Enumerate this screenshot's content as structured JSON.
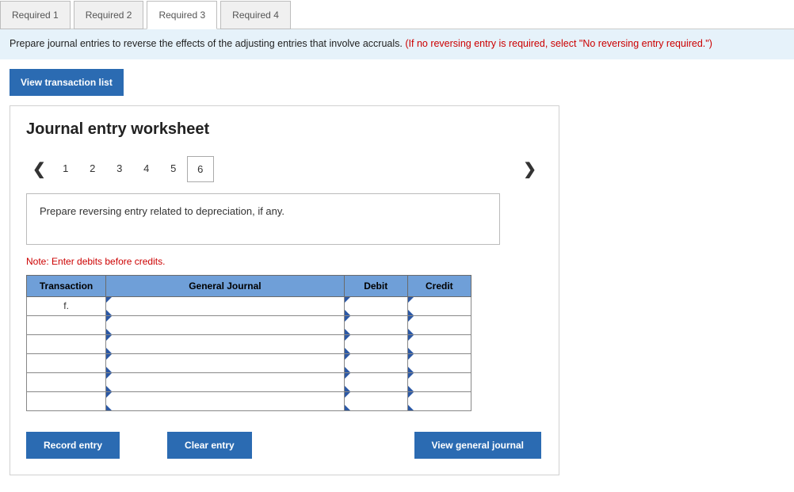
{
  "tabs": {
    "items": [
      {
        "label": "Required 1"
      },
      {
        "label": "Required 2"
      },
      {
        "label": "Required 3"
      },
      {
        "label": "Required 4"
      }
    ],
    "activeIndex": 2
  },
  "instruction": {
    "main": "Prepare journal entries to reverse the effects of the adjusting entries that involve accruals. ",
    "hint": "(If no reversing entry is required, select \"No reversing entry required.\")"
  },
  "buttons": {
    "viewTransactionList": "View transaction list",
    "recordEntry": "Record entry",
    "clearEntry": "Clear entry",
    "viewGeneralJournal": "View general journal"
  },
  "worksheet": {
    "title": "Journal entry worksheet",
    "steps": [
      "1",
      "2",
      "3",
      "4",
      "5",
      "6"
    ],
    "activeStepIndex": 5,
    "prompt": "Prepare reversing entry related to depreciation, if any.",
    "note": "Note: Enter debits before credits.",
    "headers": {
      "transaction": "Transaction",
      "generalJournal": "General Journal",
      "debit": "Debit",
      "credit": "Credit"
    },
    "rows": [
      {
        "txn": "f.",
        "gj": "",
        "debit": "",
        "credit": ""
      },
      {
        "txn": "",
        "gj": "",
        "debit": "",
        "credit": ""
      },
      {
        "txn": "",
        "gj": "",
        "debit": "",
        "credit": ""
      },
      {
        "txn": "",
        "gj": "",
        "debit": "",
        "credit": ""
      },
      {
        "txn": "",
        "gj": "",
        "debit": "",
        "credit": ""
      },
      {
        "txn": "",
        "gj": "",
        "debit": "",
        "credit": ""
      }
    ]
  }
}
